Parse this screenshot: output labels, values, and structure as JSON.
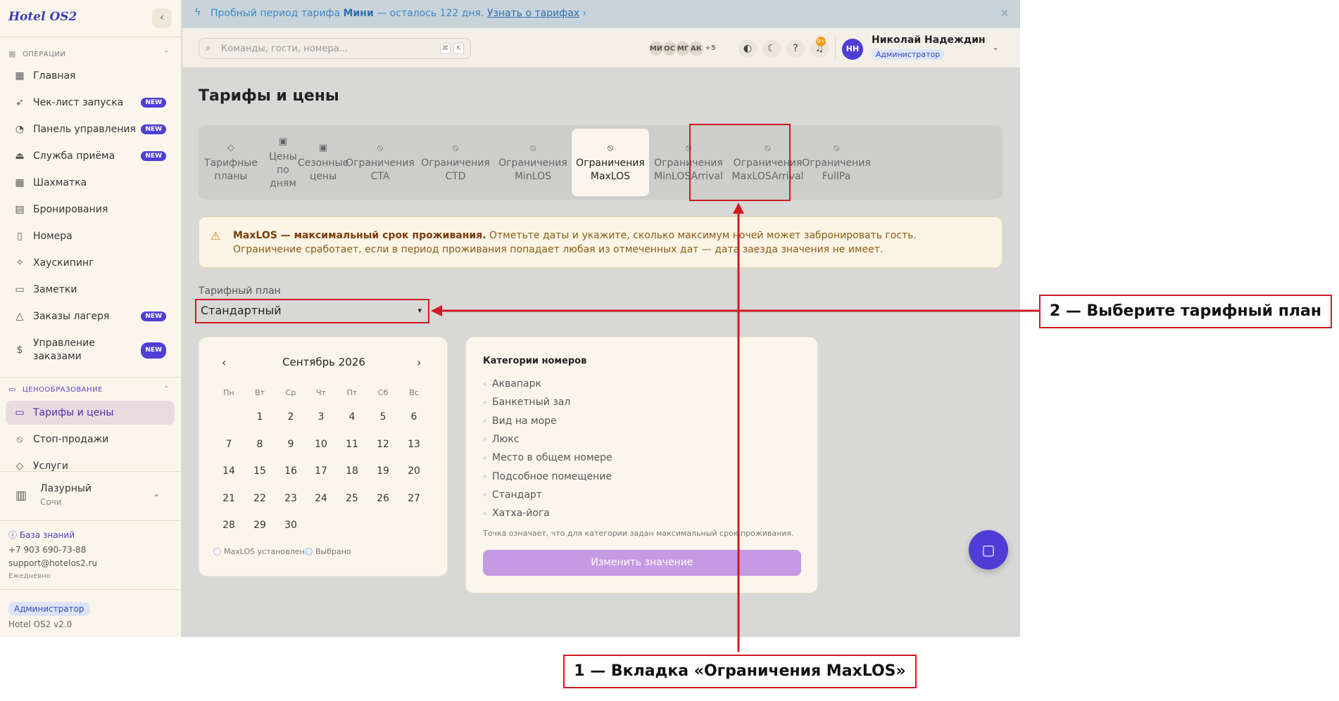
{
  "sidebar": {
    "logo": "Hotel OS2",
    "sections": {
      "operations": "ОПЕРАЦИИ",
      "pricing": "ЦЕНООБРАЗОВАНИЕ"
    },
    "items": [
      {
        "label": "Главная",
        "icon": "grid-icon"
      },
      {
        "label": "Чек-лист запуска",
        "icon": "rocket-icon",
        "badge": "NEW"
      },
      {
        "label": "Панель управления",
        "icon": "gauge-icon",
        "badge": "NEW"
      },
      {
        "label": "Служба приёма",
        "icon": "bell-service-icon",
        "badge": "NEW"
      },
      {
        "label": "Шахматка",
        "icon": "table-grid-icon"
      },
      {
        "label": "Бронирования",
        "icon": "clipboard-icon"
      },
      {
        "label": "Номера",
        "icon": "door-icon"
      },
      {
        "label": "Хаускипинг",
        "icon": "sparkle-icon"
      },
      {
        "label": "Заметки",
        "icon": "note-icon"
      },
      {
        "label": "Заказы лагеря",
        "icon": "tent-icon",
        "badge": "NEW"
      },
      {
        "label": "Управление заказами",
        "icon": "dollar-icon",
        "badge": "NEW"
      }
    ],
    "pricing_items": [
      {
        "label": "Тарифы и цены",
        "icon": "card-icon"
      },
      {
        "label": "Стоп-продажи",
        "icon": "ban-icon"
      },
      {
        "label": "Услуги",
        "icon": "tag-icon"
      }
    ],
    "hotel": {
      "name": "Лазурный",
      "city": "Сочи"
    },
    "support": {
      "kb": "База знаний",
      "phone": "+7 903 690-73-88",
      "email": "support@hotelos2.ru",
      "hours": "Ежедневно"
    },
    "role": "Администратор",
    "version": "Hotel OS2 v2.0"
  },
  "banner": {
    "prefix": "Пробный период тарифа",
    "plan": "Мини",
    "suffix": "— осталось 122 дня.",
    "link": "Узнать о тарифах"
  },
  "topbar": {
    "search_placeholder": "Команды, гости, номера...",
    "kbd1": "⌘",
    "kbd2": "K",
    "avatars": [
      "МИ",
      "ОС",
      "МГ",
      "АК"
    ],
    "avatars_more": "+5",
    "notif_count": "9+",
    "user": {
      "initials": "НН",
      "name": "Николай Надеждин",
      "role": "Администратор"
    }
  },
  "main": {
    "title": "Тарифы и цены",
    "tabs": [
      {
        "label": "Тарифные планы",
        "icon": "tag-icon"
      },
      {
        "label": "Цены по дням",
        "icon": "calendar-icon"
      },
      {
        "label": "Сезонные цены",
        "icon": "calendar-icon"
      },
      {
        "label": "Ограничения CTA",
        "icon": "ban-icon"
      },
      {
        "label": "Ограничения CTD",
        "icon": "ban-icon"
      },
      {
        "label": "Ограничения MinLOS",
        "icon": "ban-icon"
      },
      {
        "label": "Ограничения MaxLOS",
        "icon": "ban-icon",
        "active": true
      },
      {
        "label": "Ограничения MinLOSArrival",
        "icon": "ban-icon"
      },
      {
        "label": "Ограничения MaxLOSArrival",
        "icon": "ban-icon"
      },
      {
        "label": "Ограничения FullPa",
        "icon": "ban-icon"
      }
    ],
    "alert": {
      "bold": "MaxLOS — максимальный срок проживания.",
      "text": "Отметьте даты и укажите, сколько максимум ночей может забронировать гость. Ограничение сработает, если в период проживания попадает любая из отмеченных дат — дата заезда значения не имеет."
    },
    "rate_plan": {
      "label": "Тарифный план",
      "value": "Стандартный"
    },
    "calendar": {
      "month": "Сентябрь 2026",
      "dow": [
        "Пн",
        "Вт",
        "Ср",
        "Чт",
        "Пт",
        "Сб",
        "Вс"
      ],
      "first_weekday_index": 1,
      "days": 30,
      "legend_set": "MaxLOS установлен",
      "legend_selected": "Выбрано"
    },
    "categories": {
      "title": "Категории номеров",
      "items": [
        "Аквапарк",
        "Банкетный зал",
        "Вид на море",
        "Люкс",
        "Место в общем номере",
        "Подсобное помещение",
        "Стандарт",
        "Хатха-йога"
      ],
      "note": "Точка означает, что для категории задан максимальный срок проживания.",
      "button": "Изменить значение"
    }
  },
  "annotations": {
    "callout1": "1 — Вкладка «Ограничения MaxLOS»",
    "callout2": "2 — Выберите тарифный план"
  },
  "colors": {
    "accent": "#4f3ed6",
    "annotation": "#d11a22"
  }
}
